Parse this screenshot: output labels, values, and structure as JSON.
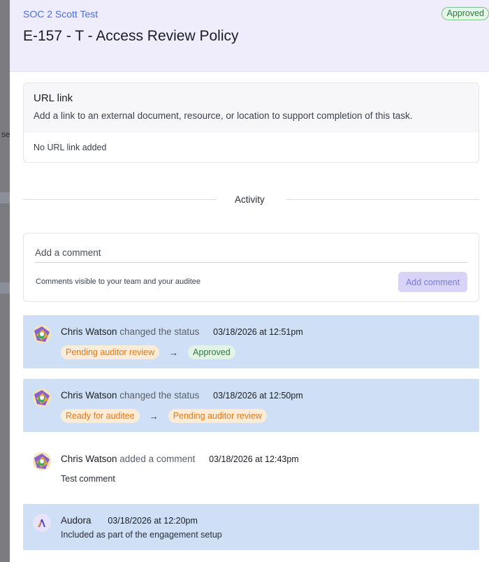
{
  "backdrop": {
    "text": "se"
  },
  "header": {
    "breadcrumb": "SOC 2 Scott Test",
    "title": "E-157 - T - Access Review Policy",
    "status": "Approved"
  },
  "url_link": {
    "title": "URL link",
    "description": "Add a link to an external document, resource, or location to support completion of this task.",
    "empty_text": "No URL link added"
  },
  "activity": {
    "heading": "Activity",
    "comment": {
      "placeholder": "Add a comment",
      "note": "Comments visible to your team and your auditee",
      "button_label": "Add comment"
    },
    "items": [
      {
        "actor": "Chris Watson",
        "action": "changed the status",
        "timestamp": "03/18/2026 at 12:51pm",
        "from_status": "Pending auditor review",
        "arrow": "→",
        "to_status": "Approved"
      },
      {
        "actor": "Chris Watson",
        "action": "changed the status",
        "timestamp": "03/18/2026 at 12:50pm",
        "from_status": "Ready for auditee",
        "arrow": "→",
        "to_status": "Pending auditor review"
      },
      {
        "actor": "Chris Watson",
        "action": "added a comment",
        "timestamp": "03/18/2026 at 12:43pm",
        "body": "Test comment"
      },
      {
        "actor": "Audora",
        "timestamp": "03/18/2026 at 12:20pm",
        "body": "Included as part of the engagement setup"
      }
    ]
  },
  "colors": {
    "header_bg": "#efedfb",
    "highlight_bg": "#cfe0f6",
    "accent": "#4a6fdc",
    "approved": "#2f7a3e",
    "pending": "#e07a1f"
  }
}
